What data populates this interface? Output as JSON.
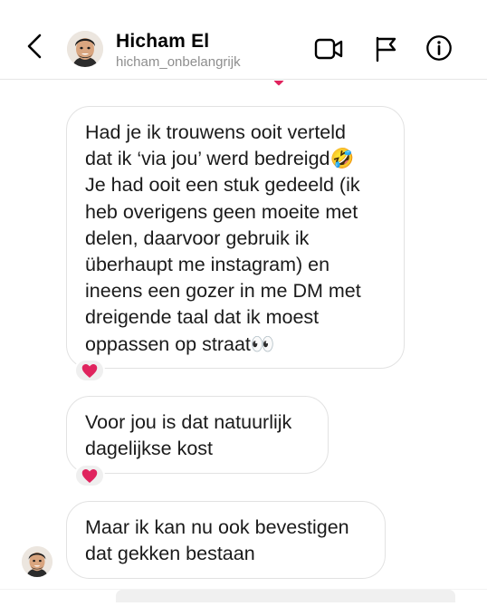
{
  "header": {
    "name": "Hicham El",
    "username": "hicham_onbelangrijk",
    "icons": [
      "back-arrow-icon",
      "video-call-icon",
      "flag-icon",
      "info-icon"
    ]
  },
  "messages": [
    {
      "sender": "me",
      "text": "Had je ik trouwens ooit verteld\ndat ik ‘via jou’ werd bedreigd🤣\nJe had ooit een stuk gedeeld  (ik\nheb overigens geen moeite met\ndelen, daarvoor gebruik ik\nüberhaupt me instagram) en\nineens een gozer in me DM met\ndreigende taal dat ik moest\noppassen op straat👀",
      "reaction": "❤️"
    },
    {
      "sender": "me",
      "text": "Voor jou is dat natuurlijk\ndagelijkse kost",
      "reaction": "❤️"
    },
    {
      "sender": "me",
      "text": "Maar ik kan nu ook bevestigen\ndat gekken bestaan",
      "reaction": ""
    }
  ],
  "colors": {
    "bubble_border": "#e2e2e2",
    "heart": "#e0245e",
    "secondary_text": "#8e8e8e"
  }
}
